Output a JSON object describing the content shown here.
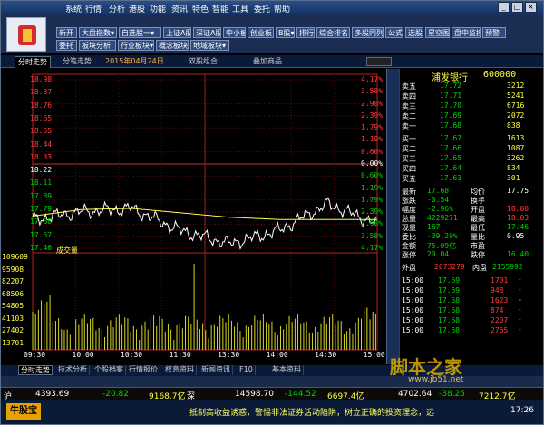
{
  "app": {
    "menu": [
      "系统",
      "行情",
      "分析",
      "港股",
      "功能",
      "资讯",
      "特色",
      "智能",
      "工具",
      "委托",
      "帮助"
    ]
  },
  "toolbar": {
    "row1": [
      "新开",
      "大盘指数▾",
      "自选股一▾",
      "上证A股",
      "深证A股",
      "中小板",
      "创业板",
      "B股▾",
      "排行▾",
      "综合排名",
      "多股同列",
      "公式",
      "选股",
      "星空图",
      "盘中监控",
      "预警"
    ],
    "row2": [
      "委托",
      "板块分析",
      "行业板块▾",
      "概念板块▾",
      "地域板块▾"
    ]
  },
  "tabs": {
    "active": "分时走势",
    "items": [
      "分笔走势"
    ],
    "date": "2015年04月24日",
    "combo": "双股组合",
    "overlay": "叠加商品"
  },
  "chart": {
    "left_prices": [
      "18.98",
      "18.87",
      "18.76",
      "18.65",
      "18.55",
      "18.44",
      "18.33",
      "18.22",
      "18.11",
      "17.89",
      "17.79",
      "17.68",
      "17.57",
      "17.46"
    ],
    "right_pct": [
      "4.17%",
      "3.58%",
      "2.98%",
      "2.39%",
      "1.79%",
      "1.19%",
      "0.60%",
      "0.00%",
      "0.60%",
      "1.19%",
      "1.79%",
      "2.39%",
      "2.98%",
      "3.58%",
      "4.17%"
    ],
    "volume_label": "成交量",
    "volume_ticks": [
      "109609",
      "95908",
      "82207",
      "68506",
      "54805",
      "41103",
      "27402",
      "13701"
    ],
    "times": [
      "09:30",
      "10:00",
      "10:30",
      "11:30",
      "13:30",
      "14:00",
      "14:30",
      "15:00"
    ],
    "sub_tabs": [
      "买卖力道",
      "量比指标",
      "成交金额",
      "成交量",
      "走势图"
    ]
  },
  "panel": {
    "name": "浦发银行",
    "code": "600000",
    "asks": [
      {
        "label": "卖五",
        "price": "17.72",
        "vol": "3212"
      },
      {
        "label": "卖四",
        "price": "17.71",
        "vol": "5241"
      },
      {
        "label": "卖三",
        "price": "17.70",
        "vol": "6716"
      },
      {
        "label": "卖二",
        "price": "17.69",
        "vol": "2072"
      },
      {
        "label": "卖一",
        "price": "17.68",
        "vol": "838"
      }
    ],
    "bids": [
      {
        "label": "买一",
        "price": "17.67",
        "vol": "1613"
      },
      {
        "label": "买二",
        "price": "17.66",
        "vol": "1087"
      },
      {
        "label": "买三",
        "price": "17.65",
        "vol": "3262"
      },
      {
        "label": "买四",
        "price": "17.64",
        "vol": "834"
      },
      {
        "label": "买五",
        "price": "17.63",
        "vol": "301"
      }
    ],
    "stats": [
      {
        "l1": "最新",
        "v1": "17.68",
        "l2": "均价",
        "v2": "17.75"
      },
      {
        "l1": "涨跌",
        "v1": "-0.54",
        "l2": "换手",
        "v2": ""
      },
      {
        "l1": "幅度",
        "v1": "-2.96%",
        "l2": "开盘",
        "v2": "18.00"
      },
      {
        "l1": "总量",
        "v1": "4229271",
        "l2": "最高",
        "v2": "18.03"
      },
      {
        "l1": "现量",
        "v1": "167",
        "l2": "最低",
        "v2": "17.46"
      },
      {
        "l1": "委比",
        "v1": "-39.20%",
        "l2": "量比",
        "v2": "0.95"
      },
      {
        "l1": "金额",
        "v1": "75.09亿",
        "l2": "市盈",
        "v2": ""
      },
      {
        "l1": "涨停",
        "v1": "20.04",
        "l2": "跌停",
        "v2": "16.40"
      }
    ],
    "outer_label": "外盘",
    "outer": "2073279",
    "inner_label": "内盘",
    "inner": "2155992",
    "ticks": [
      {
        "t": "15:00",
        "p": "17.69",
        "v": "1701",
        "d": "↑"
      },
      {
        "t": "15:00",
        "p": "17.69",
        "v": "948",
        "d": "↑"
      },
      {
        "t": "15:00",
        "p": "17.68",
        "v": "1623",
        "d": "•"
      },
      {
        "t": "15:00",
        "p": "17.68",
        "v": "874",
        "d": "↑"
      },
      {
        "t": "15:00",
        "p": "17.68",
        "v": "2207",
        "d": "↑"
      },
      {
        "t": "15:00",
        "p": "17.68",
        "v": "2765",
        "d": "↑"
      }
    ]
  },
  "bottom_tabs": [
    "分时走势",
    "技术分析",
    "个股档案",
    "行情报价",
    "权息资料",
    "新闻资讯",
    "F10",
    "基本资料"
  ],
  "status": {
    "sh_label": "沪",
    "sh_index": "4393.69",
    "sh_chg": "-20.82",
    "sh_amt": "9168.7亿",
    "sz_label": "深",
    "sz_index": "14598.70",
    "sz_chg": "-144.52",
    "sz_amt": "6697.4亿",
    "cy_index": "4702.64",
    "cy_chg": "-38.25",
    "cy_amt": "7212.7亿",
    "time": "17:26",
    "ticker": "抵制高收益诱惑，警惕非法证券活动陷阱，树立正确的投资理念，远",
    "brand": "牛股宝"
  },
  "watermark": {
    "line1": "脚本之家",
    "line2": "www.jb51.net"
  },
  "colors": {
    "up": "#ff3c3c",
    "down": "#00d200",
    "price": "#ffffff",
    "avg": "#ffff40",
    "frame": "#b02020"
  },
  "chart_data": {
    "type": "line",
    "x": [
      "09:30",
      "10:00",
      "10:30",
      "11:30",
      "13:30",
      "14:00",
      "14:30",
      "15:00"
    ],
    "ylim": [
      17.46,
      18.98
    ],
    "series": [
      {
        "values": [
          17.72,
          17.79,
          17.82,
          17.62,
          17.5,
          17.62,
          17.86,
          17.68
        ]
      },
      {
        "values": [
          17.75,
          17.81,
          17.82,
          17.78,
          17.74,
          17.72,
          17.72,
          17.72
        ]
      }
    ]
  }
}
